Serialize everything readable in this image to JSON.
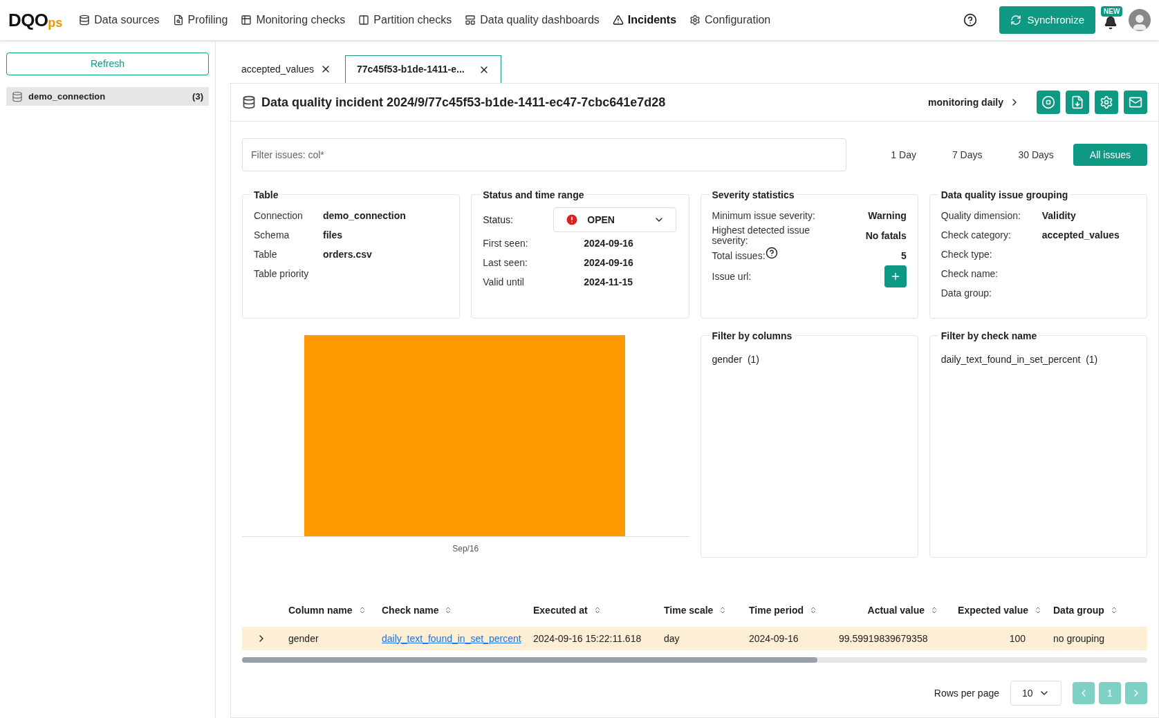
{
  "top_nav": {
    "logo_main": "DQO",
    "logo_sub": "ps",
    "items": [
      {
        "label": "Data sources",
        "selected": false
      },
      {
        "label": "Profiling",
        "selected": false
      },
      {
        "label": "Monitoring checks",
        "selected": false
      },
      {
        "label": "Partition checks",
        "selected": false
      },
      {
        "label": "Data quality dashboards",
        "selected": false
      },
      {
        "label": "Incidents",
        "selected": true
      },
      {
        "label": "Configuration",
        "selected": false
      }
    ],
    "sync_button": "Synchronize",
    "new_badge": "NEW"
  },
  "sidebar": {
    "refresh_button": "Refresh",
    "items": [
      {
        "name": "demo_connection",
        "count": "(3)",
        "selected": true
      }
    ]
  },
  "tabs": [
    {
      "label": "accepted_values",
      "selected": false
    },
    {
      "label": "77c45f53-b1de-1411-e...",
      "selected": true
    }
  ],
  "incident": {
    "title": "Data quality incident 2024/9/77c45f53-b1de-1411-ec47-7cbc641e7d28",
    "breadcrumb": "monitoring daily"
  },
  "filter": {
    "placeholder": "Filter issues: col*"
  },
  "ranges": [
    {
      "label": "1 Day",
      "selected": false
    },
    {
      "label": "7 Days",
      "selected": false
    },
    {
      "label": "30 Days",
      "selected": false
    },
    {
      "label": "All issues",
      "selected": true
    }
  ],
  "cards": [
    {
      "title": "Table",
      "rows": [
        {
          "label": "Connection",
          "value": "demo_connection"
        },
        {
          "label": "Schema",
          "value": "files"
        },
        {
          "label": "Table",
          "value": "orders.csv"
        },
        {
          "label": "Table priority"
        }
      ]
    },
    {
      "title": "Status and time range",
      "status_label": "Status:",
      "status": "OPEN",
      "rows": [
        {
          "label": "First seen:",
          "value": "2024-09-16"
        },
        {
          "label": "Last seen:",
          "value": "2024-09-16"
        },
        {
          "label": "Valid until",
          "value": "2024-11-15"
        }
      ]
    },
    {
      "title": "Severity statistics",
      "rows": [
        {
          "label": "Minimum issue severity:",
          "value": "Warning"
        },
        {
          "label": "Highest detected issue severity:",
          "value": "No fatals"
        },
        {
          "label": "Total issues:",
          "value": "5",
          "kind": "help"
        },
        {
          "label": "Issue url:",
          "kind": "add"
        }
      ]
    },
    {
      "title": "Data quality issue grouping",
      "rows": [
        {
          "label": "Quality dimension:",
          "value": "Validity"
        },
        {
          "label": "Check category:",
          "value": "accepted_values"
        },
        {
          "label": "Check type:"
        },
        {
          "label": "Check name:"
        },
        {
          "label": "Data group:"
        }
      ]
    }
  ],
  "chart": {
    "x_label": "Sep/16"
  },
  "filter_cards": [
    {
      "title": "Filter by columns",
      "items": [
        {
          "name": "gender",
          "count": "(1)"
        }
      ]
    },
    {
      "title": "Filter by check name",
      "items": [
        {
          "name": "daily_text_found_in_set_percent",
          "count": "(1)"
        }
      ]
    }
  ],
  "table": {
    "columns": [
      "Column name",
      "Check name",
      "Executed at",
      "Time scale",
      "Time period",
      "Actual value",
      "Expected value",
      "Data group"
    ],
    "rows": [
      {
        "expanded": false,
        "cells": [
          "gender",
          "daily_text_found_in_set_percent",
          "2024-09-16 15:22:11.618",
          "day",
          "2024-09-16",
          "99.59919839679358",
          "100",
          "no grouping"
        ]
      }
    ]
  },
  "pagination": {
    "rows_per_page_label": "Rows per page",
    "rows_per_page": "10",
    "page": "1"
  }
}
